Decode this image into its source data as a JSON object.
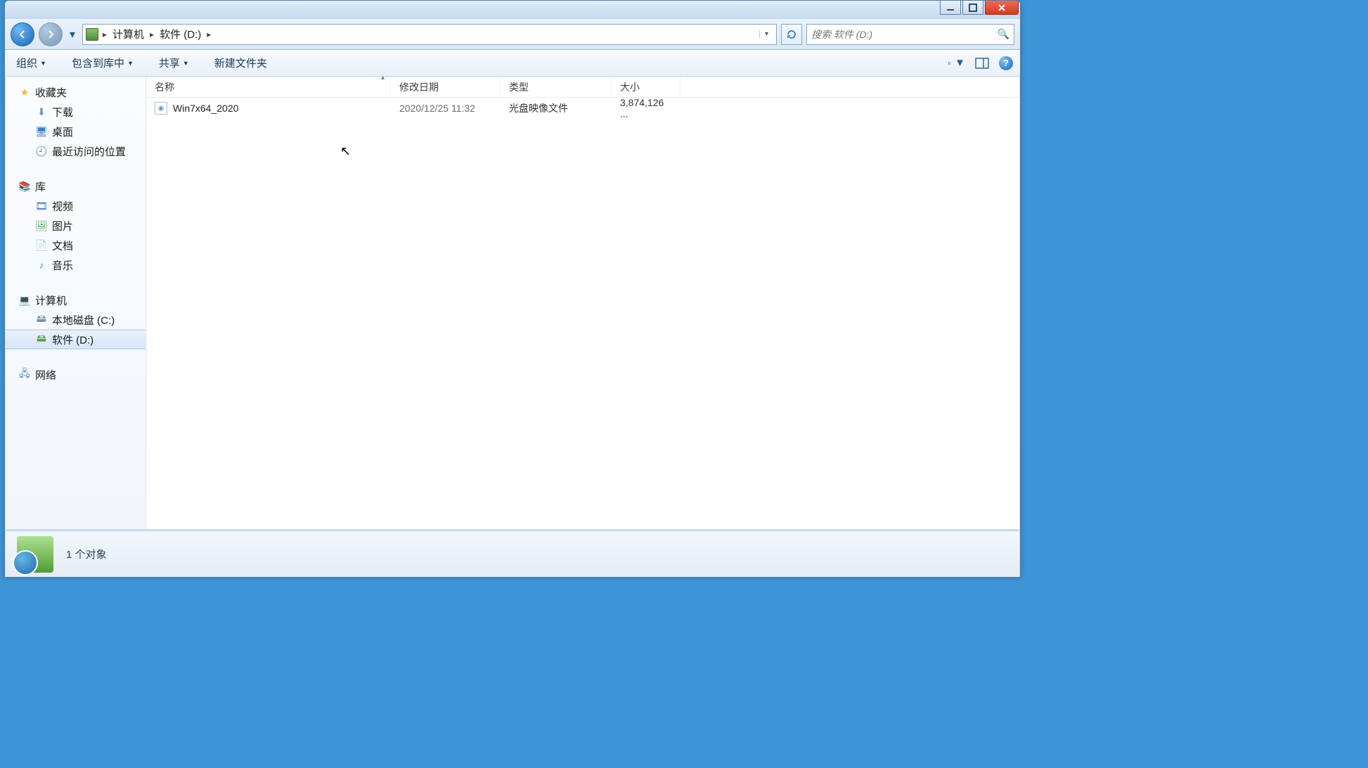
{
  "window_controls": {
    "min": "minimize",
    "max": "maximize",
    "close": "close"
  },
  "address": {
    "segments": [
      "计算机",
      "软件 (D:)"
    ]
  },
  "search": {
    "placeholder": "搜索 软件 (D:)"
  },
  "toolbar": {
    "organize": "组织",
    "include": "包含到库中",
    "share": "共享",
    "newfolder": "新建文件夹"
  },
  "columns": {
    "name": "名称",
    "date": "修改日期",
    "type": "类型",
    "size": "大小"
  },
  "files": [
    {
      "name": "Win7x64_2020",
      "date": "2020/12/25 11:32",
      "type": "光盘映像文件",
      "size": "3,874,126 ..."
    }
  ],
  "sidebar": {
    "favorites": {
      "head": "收藏夹",
      "items": [
        "下载",
        "桌面",
        "最近访问的位置"
      ]
    },
    "libraries": {
      "head": "库",
      "items": [
        "视频",
        "图片",
        "文档",
        "音乐"
      ]
    },
    "computer": {
      "head": "计算机",
      "items": [
        "本地磁盘 (C:)",
        "软件 (D:)"
      ]
    },
    "network": {
      "head": "网络"
    }
  },
  "status": {
    "text": "1 个对象"
  }
}
